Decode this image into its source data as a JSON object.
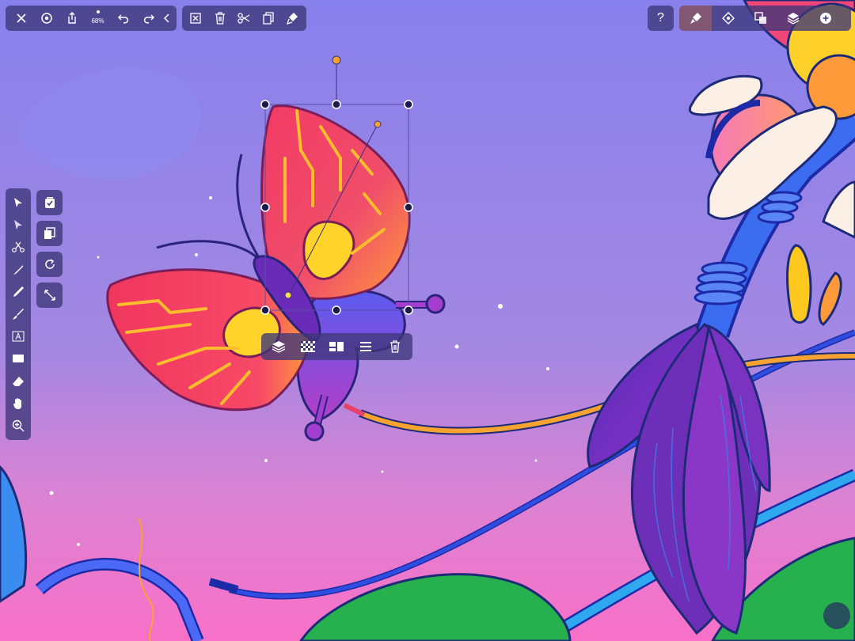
{
  "toolbar_left": {
    "zoom_label": "68%",
    "icons": [
      "close-icon",
      "settings-icon",
      "share-icon",
      "zoom-indicator",
      "undo-icon",
      "redo-icon",
      "collapse-chevron-icon"
    ]
  },
  "edit_bar": {
    "icons": [
      "deselect-icon",
      "delete-icon",
      "cut-icon",
      "copy-icon",
      "paste-icon"
    ]
  },
  "help": {
    "label": "?"
  },
  "right_bar": {
    "icons": [
      "brush-settings-icon",
      "style-icon",
      "shape-ops-icon",
      "layers-icon",
      "add-icon"
    ],
    "active_index": 0
  },
  "tools": {
    "icons": [
      "selection-tool-icon",
      "node-tool-icon",
      "scissors-tool-icon",
      "pen-tool-icon",
      "pencil-tool-icon",
      "brush-tool-icon",
      "text-tool-icon",
      "shape-tool-icon",
      "eraser-tool-icon",
      "hand-tool-icon",
      "zoom-tool-icon"
    ]
  },
  "quick_actions": {
    "icons": [
      "select-all-icon",
      "duplicate-icon",
      "rotate-icon",
      "fit-icon"
    ]
  },
  "context_bar": {
    "icons": [
      "arrange-layers-icon",
      "transparency-icon",
      "align-icon",
      "distribute-icon",
      "trash-icon"
    ]
  },
  "colors": {
    "toolbar_bg": "#3e3778",
    "sky_top": "#8b80e8",
    "sky_bottom": "#f274c9",
    "current_color": "#26505c"
  }
}
